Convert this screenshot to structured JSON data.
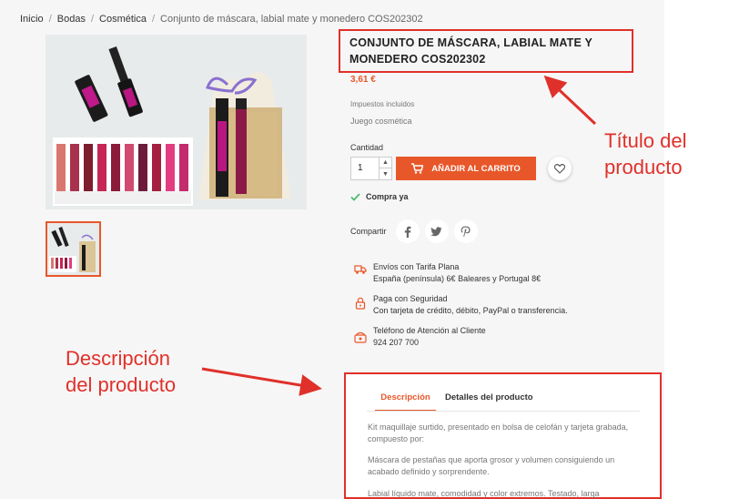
{
  "breadcrumb": {
    "items": [
      "Inicio",
      "Bodas",
      "Cosmética"
    ],
    "current": "Conjunto de máscara, labial mate y monedero COS202302"
  },
  "product": {
    "title_line1": "CONJUNTO DE MÁSCARA, LABIAL MATE Y",
    "title_line2": "MONEDERO COS202302",
    "price": "3,61 €",
    "tax_note": "Impuestos incluidos",
    "short_description": "Juego cosmética",
    "quantity_label": "Cantidad",
    "quantity_value": "1",
    "add_to_cart_label": "AÑADIR AL CARRITO",
    "availability": "Compra ya",
    "share_label": "Compartir"
  },
  "reassurance": [
    {
      "icon": "truck-icon",
      "line1": "Envíos con Tarifa Plana",
      "line2": "España (península) 6€ Baleares y Portugal 8€"
    },
    {
      "icon": "lock-icon",
      "line1": "Paga con Seguridad",
      "line2": "Con tarjeta de crédito, débito, PayPal o transferencia."
    },
    {
      "icon": "phone-icon",
      "line1": "Teléfono de Atención al Cliente",
      "line2": "924 207 700"
    }
  ],
  "tabs": {
    "description": "Descripción",
    "details": "Detalles del producto"
  },
  "description": {
    "p1_line1": "Kit maquillaje surtido, presentado en bolsa de celofán y tarjeta grabada,",
    "p1_line2": "compuesto por:",
    "p2_line1": "Máscara de pestañas que aporta grosor y volumen consiguiendo un",
    "p2_line2": "acabado definido y sorprendente.",
    "p3_line1": "Labial líquido mate, comodidad y color extremos. Testado, larga"
  },
  "annotations": {
    "title_note_line1": "Título del",
    "title_note_line2": "producto",
    "desc_note_line1": "Descripción",
    "desc_note_line2": "del producto"
  },
  "colors": {
    "accent": "#e8572a",
    "annotation": "#e0302a"
  }
}
